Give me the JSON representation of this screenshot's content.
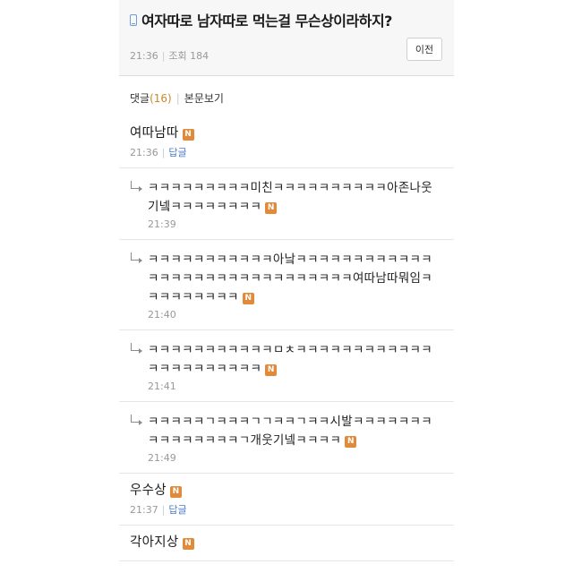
{
  "post": {
    "title": "여자따로 남자따로 먹는걸 무슨상이라하지?",
    "time": "21:36",
    "views_label": "조회 184",
    "prev_button": "이전"
  },
  "comment_bar": {
    "label": "댓글",
    "count": "(16)",
    "view_body": "본문보기"
  },
  "badge": "N",
  "comments": [
    {
      "type": "top",
      "text": "여따남따",
      "time": "21:36",
      "reply_label": "답글"
    },
    {
      "type": "reply",
      "text": "ㅋㅋㅋㅋㅋㅋㅋㅋㅋ미친ㅋㅋㅋㅋㅋㅋㅋㅋㅋㅋ아존나웃기넼ㅋㅋㅋㅋㅋㅋㅋㅋ",
      "time": "21:39"
    },
    {
      "type": "reply",
      "text": "ㅋㅋㅋㅋㅋㅋㅋㅋㅋㅋㅋ아낰ㅋㅋㅋㅋㅋㅋㅋㅋㅋㅋㅋㅋㅋㅋㅋㅋㅋㅋㅋㅋㅋㅋㅋㅋㅋㅋㅋㅋㅋㅋ여따남따뭐임ㅋㅋㅋㅋㅋㅋㅋㅋㅋ",
      "time": "21:40"
    },
    {
      "type": "reply",
      "text": "ㅋㅋㅋㅋㅋㅋㅋㅋㅋㅋㅋㅁㅊㅋㅋㅋㅋㅋㅋㅋㅋㅋㅋㅋㅋㅋㅋㅋㅋㅋㅋㅋㅋㅋㅋ",
      "time": "21:41"
    },
    {
      "type": "reply",
      "text": "ㅋㅋㅋㅋㅋㄱㅋㅋㅋㄱㄱㅋㅋㄱㅋㅋ시발ㅋㅋㅋㅋㅋㅋㅋㅋㅋㅋㅋㅋㅋㅋㅋㄱ개웃기넼ㅋㅋㅋㅋ",
      "time": "21:49"
    },
    {
      "type": "top",
      "text": "우수상",
      "time": "21:37",
      "reply_label": "답글"
    },
    {
      "type": "top",
      "text": "각아지상",
      "time": "",
      "reply_label": ""
    }
  ]
}
